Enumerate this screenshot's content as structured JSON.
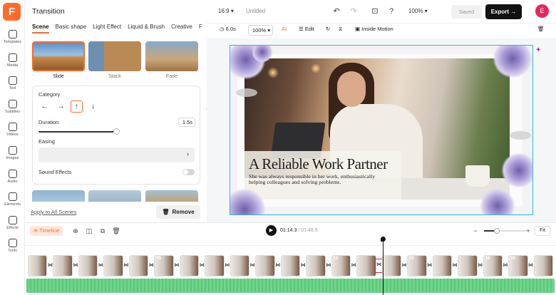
{
  "app": {
    "logo_letter": "F",
    "brand_color": "#ff6a2b",
    "selection_color": "#2bb8e6"
  },
  "sidebar": {
    "items": [
      {
        "label": "Templates",
        "icon": "templates-icon"
      },
      {
        "label": "Media",
        "icon": "media-icon"
      },
      {
        "label": "Text",
        "icon": "text-icon"
      },
      {
        "label": "Subtitles",
        "icon": "subtitles-icon"
      },
      {
        "label": "Videos",
        "icon": "videos-icon"
      },
      {
        "label": "Images",
        "icon": "images-icon"
      },
      {
        "label": "Audio",
        "icon": "audio-icon"
      },
      {
        "label": "Elements",
        "icon": "elements-icon"
      },
      {
        "label": "Effects",
        "icon": "effects-icon"
      },
      {
        "label": "Tools",
        "icon": "tools-icon"
      }
    ]
  },
  "panel": {
    "title": "Transition",
    "tabs": [
      "Scene",
      "Basic shape",
      "Light Effect",
      "Liquid & Brush",
      "Creative",
      "F"
    ],
    "active_tab": "Scene",
    "presets": [
      "Slide",
      "Stack",
      "Fade"
    ],
    "selected_preset": "Slide",
    "category_label": "Category",
    "directions": [
      "←",
      "→",
      "↑",
      "↓"
    ],
    "selected_direction": "↑",
    "duration_label": "Duration",
    "duration_value": "1.5s",
    "duration_fraction": 0.71,
    "easing_label": "Easing",
    "sound_label": "Sound Effects",
    "sound_enabled": false,
    "apply_all": "Apply to All Scenes",
    "remove_label": "Remove"
  },
  "topbar": {
    "aspect": "16:9",
    "title": "Untitled",
    "zoom": "100%",
    "saved": "Saved",
    "export": "Export",
    "avatar_letter": "E"
  },
  "edit_toolbar": {
    "duration": "6.0s",
    "zoom": "100%",
    "edit": "Edit",
    "inside_motion": "Inside Motion"
  },
  "canvas": {
    "title": "A Reliable Work Partner",
    "body": "She was always responsible in her work, enthusiastically helping colleagues and solving problems."
  },
  "timeline": {
    "label": "Timeline",
    "current_time": "01:14.3",
    "total_time": "01:48.5",
    "zoom_fraction": 0.3,
    "fit_label": "Fit",
    "scene_numbers": [
      "",
      "",
      "",
      "",
      "",
      "05",
      "",
      "",
      "",
      "",
      "",
      "",
      "12",
      "",
      "",
      "15",
      "",
      "",
      "18",
      "19",
      ""
    ]
  }
}
